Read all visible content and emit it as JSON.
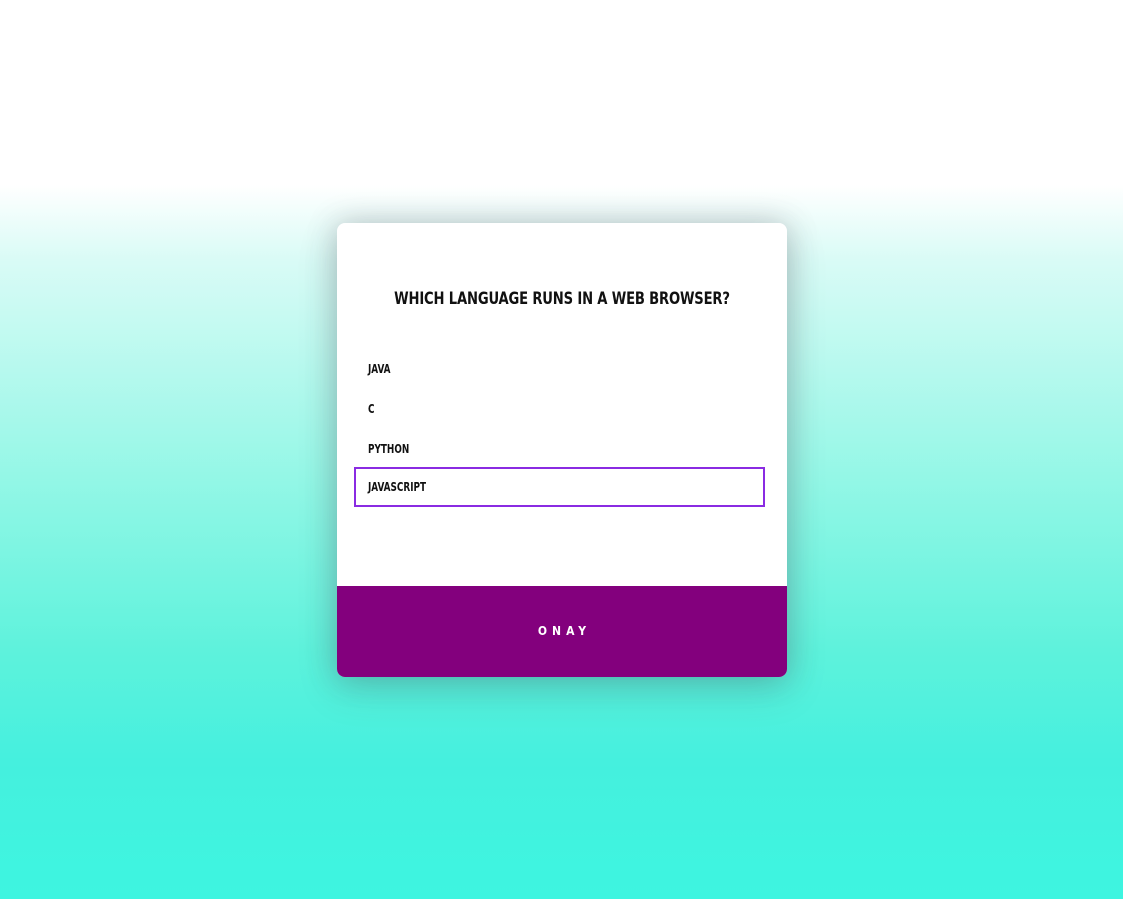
{
  "quiz": {
    "question": "WHICH LANGUAGE RUNS IN A WEB BROWSER?",
    "options": [
      {
        "label": "JAVA",
        "selected": false
      },
      {
        "label": "C",
        "selected": false
      },
      {
        "label": "PYTHON",
        "selected": false
      },
      {
        "label": "JAVASCRIPT",
        "selected": true
      }
    ],
    "submit_label": "ONAY"
  },
  "colors": {
    "accent": "#8a2be2",
    "button_background": "#83007d",
    "background_top": "#ffffff",
    "background_bottom": "#3df5e0"
  }
}
